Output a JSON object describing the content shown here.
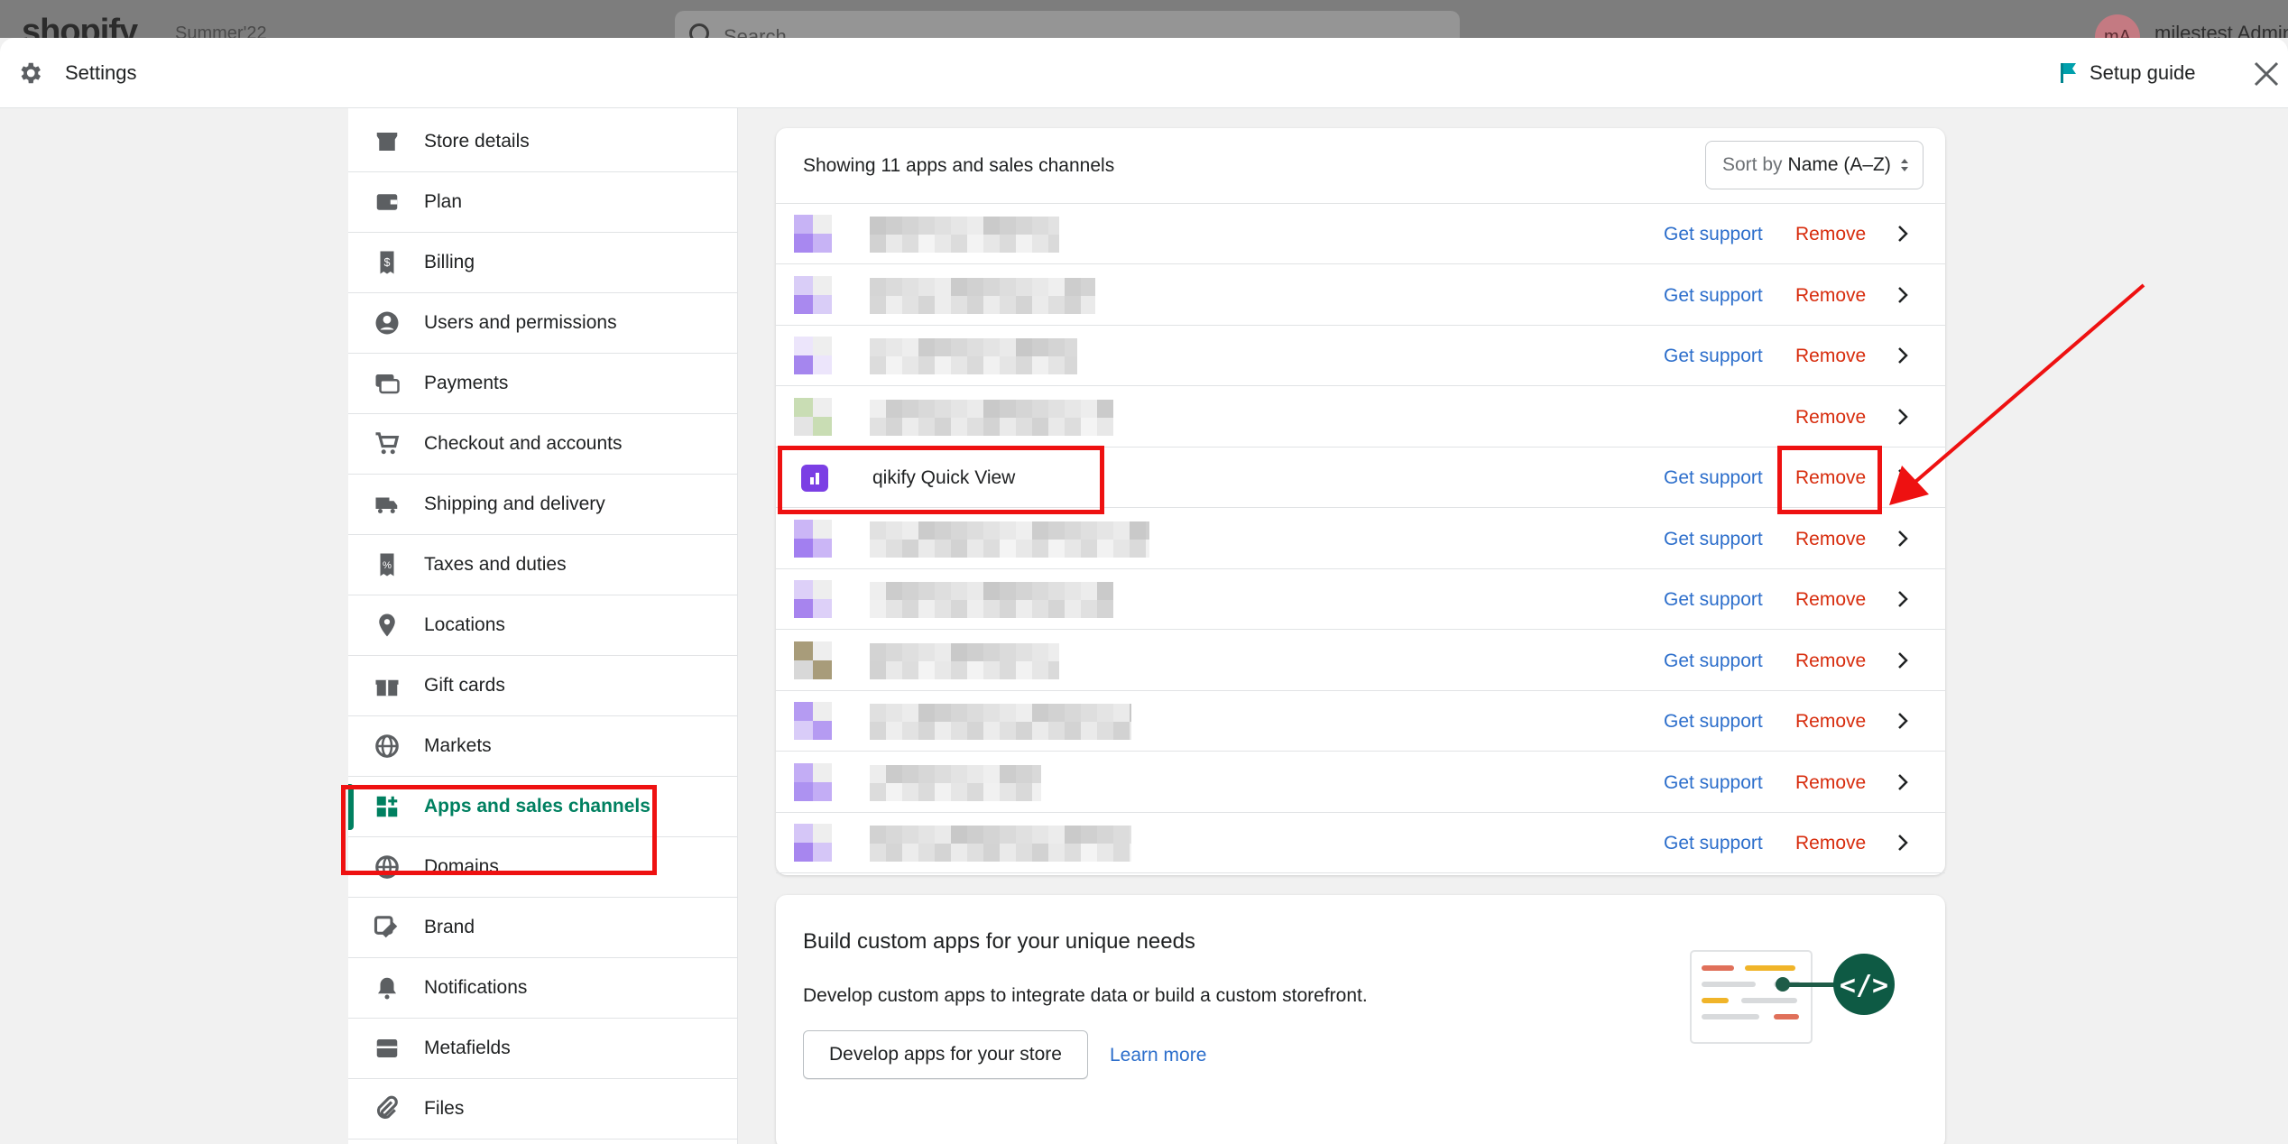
{
  "backdrop": {
    "logo": "shopify",
    "store": "Summer'22",
    "search_placeholder": "Search",
    "avatar_initials": "mA",
    "user_name": "milestest Admin"
  },
  "modal": {
    "title": "Settings",
    "setup_guide": "Setup guide"
  },
  "sidebar": {
    "items": [
      {
        "label": "Store details",
        "icon": "store-icon"
      },
      {
        "label": "Plan",
        "icon": "plan-icon"
      },
      {
        "label": "Billing",
        "icon": "billing-icon"
      },
      {
        "label": "Users and permissions",
        "icon": "user-icon"
      },
      {
        "label": "Payments",
        "icon": "payments-icon"
      },
      {
        "label": "Checkout and accounts",
        "icon": "cart-icon"
      },
      {
        "label": "Shipping and delivery",
        "icon": "truck-icon"
      },
      {
        "label": "Taxes and duties",
        "icon": "tax-icon"
      },
      {
        "label": "Locations",
        "icon": "location-icon"
      },
      {
        "label": "Gift cards",
        "icon": "gift-icon"
      },
      {
        "label": "Markets",
        "icon": "globe-icon"
      },
      {
        "label": "Apps and sales channels",
        "icon": "apps-icon",
        "active": true
      },
      {
        "label": "Domains",
        "icon": "domains-icon"
      },
      {
        "label": "Brand",
        "icon": "brand-icon"
      },
      {
        "label": "Notifications",
        "icon": "bell-icon"
      },
      {
        "label": "Metafields",
        "icon": "metafields-icon"
      },
      {
        "label": "Files",
        "icon": "files-icon"
      }
    ]
  },
  "apps": {
    "count_text": "Showing 11 apps and sales channels",
    "sort_prefix": "Sort by",
    "sort_value": "Name (A–Z)",
    "support_label": "Get support",
    "remove_label": "Remove",
    "visible_app_name": "qikify Quick View"
  },
  "build": {
    "title": "Build custom apps for your unique needs",
    "description": "Develop custom apps to integrate data or build a custom storefront.",
    "button": "Develop apps for your store",
    "learn_more": "Learn more"
  },
  "colors": {
    "accent_green": "#008060",
    "link_blue": "#2c6ecb",
    "remove_red": "#d72c0d",
    "highlight_red": "#ee1111",
    "app_purple": "#7b3fe4"
  }
}
